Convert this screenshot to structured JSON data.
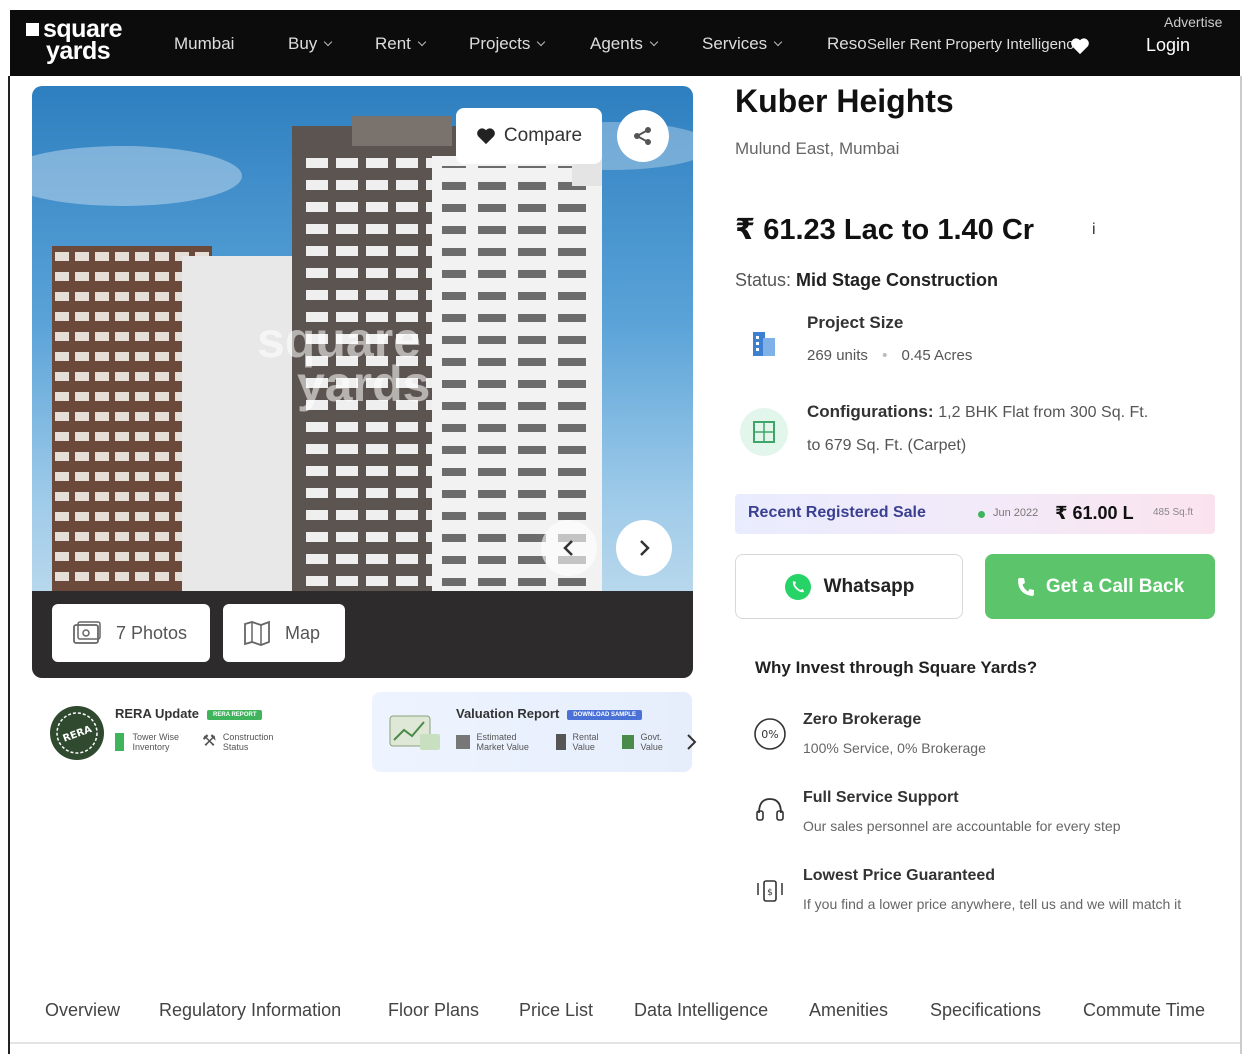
{
  "header": {
    "logo_line1": "square",
    "logo_line2": "yards",
    "nav": [
      {
        "label": "Mumbai",
        "dropdown": false
      },
      {
        "label": "Buy",
        "dropdown": true
      },
      {
        "label": "Rent",
        "dropdown": true
      },
      {
        "label": "Projects",
        "dropdown": true
      },
      {
        "label": "Agents",
        "dropdown": true
      },
      {
        "label": "Services",
        "dropdown": true
      },
      {
        "label": "Reso",
        "dropdown": false
      },
      {
        "label": "Seller Rent Property Intelligence",
        "dropdown": false
      }
    ],
    "login": "Login",
    "advertise": "Advertise"
  },
  "gallery": {
    "watermark_line1": "square",
    "watermark_line2": "yards",
    "compare_label": "Compare",
    "photos_label": "7 Photos",
    "map_label": "Map"
  },
  "reports": {
    "rera_title": "RERA Update",
    "rera_tag": "RERA REPORT",
    "rera_items": [
      "Tower Wise Inventory",
      "Construction Status"
    ],
    "valuation_title": "Valuation Report",
    "valuation_tag": "DOWNLOAD SAMPLE",
    "valuation_items": [
      "Estimated Market Value",
      "Rental Value",
      "Govt. Value"
    ]
  },
  "project": {
    "title": "Kuber Heights",
    "location": "Mulund East, Mumbai",
    "price": "₹ 61.23 Lac to 1.40 Cr",
    "info_icon": "i",
    "status_label": "Status:",
    "status_value": "Mid Stage Construction",
    "size_title": "Project Size",
    "size_units": "269 units",
    "size_area": "0.45 Acres",
    "config_title": "Configurations:",
    "config_line1": "1,2 BHK Flat from 300 Sq. Ft.",
    "config_line2": "to 679 Sq. Ft. (Carpet)"
  },
  "recent_sale": {
    "label": "Recent Registered Sale",
    "date": "Jun 2022",
    "price": "₹ 61.00 L",
    "area": "485 Sq.ft"
  },
  "actions": {
    "whatsapp": "Whatsapp",
    "callback": "Get a Call Back"
  },
  "why": {
    "title": "Why Invest through Square Yards?",
    "items": [
      {
        "title": "Zero Brokerage",
        "sub": "100% Service, 0% Brokerage"
      },
      {
        "title": "Full Service Support",
        "sub": "Our sales personnel are accountable for every step"
      },
      {
        "title": "Lowest Price Guaranteed",
        "sub": "If you find a lower price anywhere, tell us and we will match it"
      }
    ]
  },
  "tabs": [
    "Overview",
    "Regulatory Information",
    "Floor Plans",
    "Price List",
    "Data Intelligence",
    "Amenities",
    "Specifications",
    "Commute Time"
  ],
  "colors": {
    "nav_bg": "#0c0c0c",
    "call_green": "#5cc46a",
    "whatsapp_green": "#25d366",
    "rera_green": "#3fb45c"
  }
}
